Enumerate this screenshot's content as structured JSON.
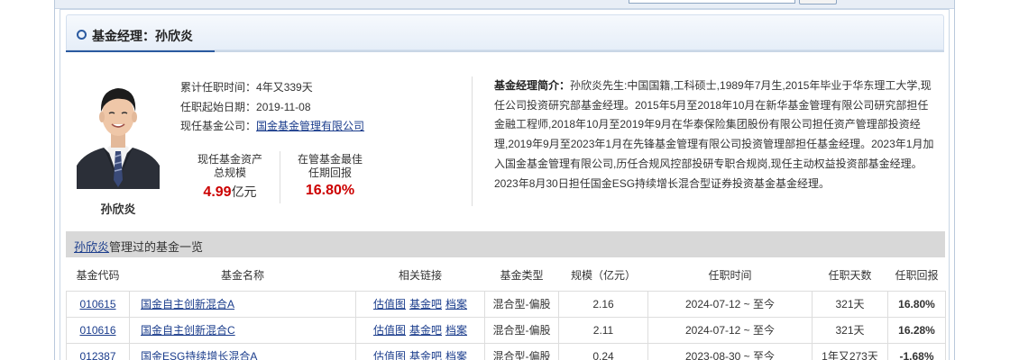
{
  "title": "基金经理：孙欣炎",
  "manager": {
    "name": "孙欣炎",
    "tenure_label": "累计任职时间：",
    "tenure_value": "4年又339天",
    "start_label": "任职起始日期：",
    "start_value": "2019-11-08",
    "company_label": "现任基金公司：",
    "company_value": "国金基金管理有限公司",
    "assets_label_1": "现任基金资产",
    "assets_label_2": "总规模",
    "assets_value": "4.99",
    "assets_unit": "亿元",
    "best_return_label_1": "在管基金最佳",
    "best_return_label_2": "任期回报",
    "best_return_value": "16.80%"
  },
  "bio": {
    "label": "基金经理简介：",
    "text": "孙欣炎先生:中国国籍,工科硕士,1989年7月生,2015年毕业于华东理工大学,现任公司投资研究部基金经理。2015年5月至2018年10月在新华基金管理有限公司研究部担任金融工程师,2018年10月至2019年9月在华泰保险集团股份有限公司担任资产管理部投资经理,2019年9月至2023年1月在先锋基金管理有限公司投资管理部担任基金经理。2023年1月加入国金基金管理有限公司,历任合规风控部投研专职合规岗,现任主动权益投资部基金经理。2023年8月30日担任国金ESG持续增长混合型证券投资基金基金经理。"
  },
  "fund_list": {
    "title_link": "孙欣炎",
    "title_suffix": "管理过的基金一览",
    "columns": [
      "基金代码",
      "基金名称",
      "相关链接",
      "基金类型",
      "规模（亿元）",
      "任职时间",
      "任职天数",
      "任职回报"
    ],
    "link_labels": [
      "估值图",
      "基金吧",
      "档案"
    ],
    "rows": [
      {
        "code": "010615",
        "name": "国金自主创新混合A",
        "type": "混合型-偏股",
        "size": "2.16",
        "period": "2024-07-12 ~ 至今",
        "days": "321天",
        "return": "16.80%",
        "return_dir": "up"
      },
      {
        "code": "010616",
        "name": "国金自主创新混合C",
        "type": "混合型-偏股",
        "size": "2.11",
        "period": "2024-07-12 ~ 至今",
        "days": "321天",
        "return": "16.28%",
        "return_dir": "up"
      },
      {
        "code": "012387",
        "name": "国金ESG持续增长混合A",
        "type": "混合型-偏股",
        "size": "0.24",
        "period": "2023-08-30 ~ 至今",
        "days": "1年又273天",
        "return": "-1.68%",
        "return_dir": "down"
      }
    ]
  },
  "colors": {
    "accent": "#2b5aa0",
    "link": "#1a3c8c",
    "positive": "#cc0000",
    "negative": "#008800"
  }
}
